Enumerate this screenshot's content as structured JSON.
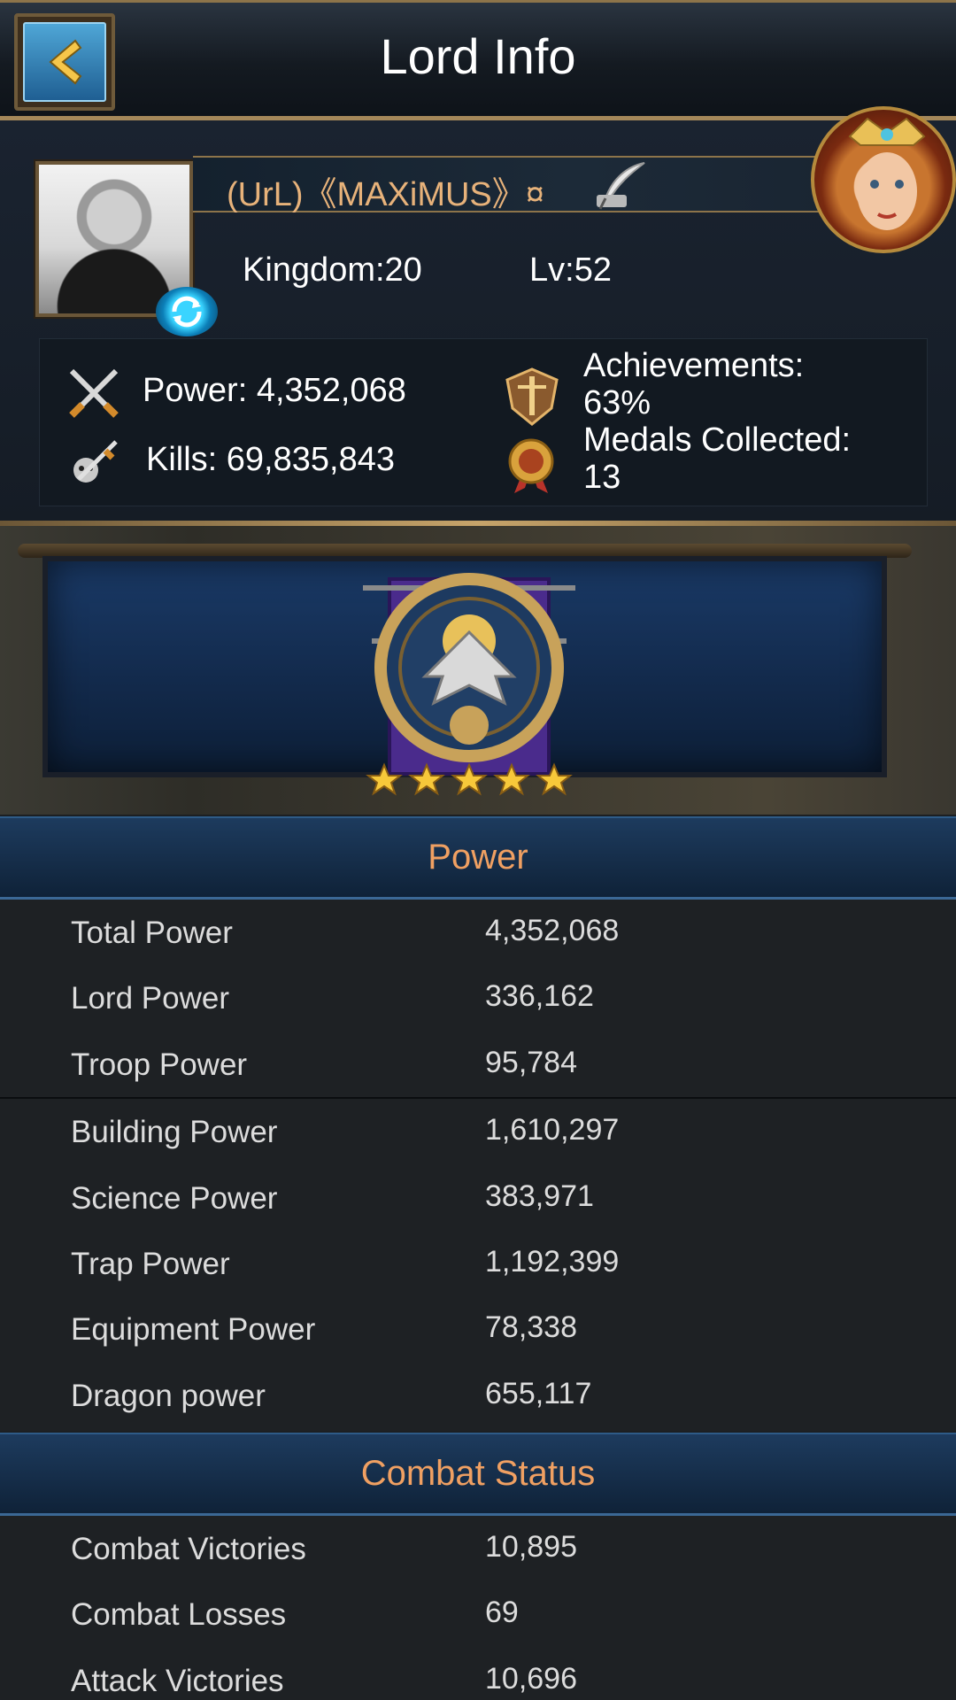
{
  "header": {
    "title": "Lord Info",
    "back_icon": "chevron-left-icon"
  },
  "profile": {
    "name": "(UrL)《MAXiMUS》¤",
    "kingdom": "Kingdom:20",
    "level": "Lv:52",
    "stats": {
      "power": "Power: 4,352,068",
      "kills": "Kills: 69,835,843",
      "achievements_label": "Achievements:",
      "achievements_value": "63%",
      "medals_label": "Medals Collected:",
      "medals_value": "13"
    }
  },
  "banner": {
    "stars": 5
  },
  "power_section": {
    "title": "Power",
    "rows": [
      {
        "label": "Total Power",
        "value": "4,352,068"
      },
      {
        "label": "Lord Power",
        "value": "336,162"
      },
      {
        "label": "Troop Power",
        "value": "95,784"
      },
      {
        "label": "Building Power",
        "value": "1,610,297"
      },
      {
        "label": "Science Power",
        "value": "383,971"
      },
      {
        "label": "Trap Power",
        "value": "1,192,399"
      },
      {
        "label": "Equipment Power",
        "value": "78,338"
      },
      {
        "label": "Dragon power",
        "value": "655,117"
      }
    ]
  },
  "combat_section": {
    "title": "Combat Status",
    "rows": [
      {
        "label": "Combat Victories",
        "value": "10,895"
      },
      {
        "label": "Combat Losses",
        "value": "69"
      },
      {
        "label": "Attack Victories",
        "value": "10,696"
      }
    ]
  },
  "colors": {
    "accent_orange": "#f0a062",
    "name_gold": "#e7b27a",
    "header_blue": "#1d3b5e"
  }
}
